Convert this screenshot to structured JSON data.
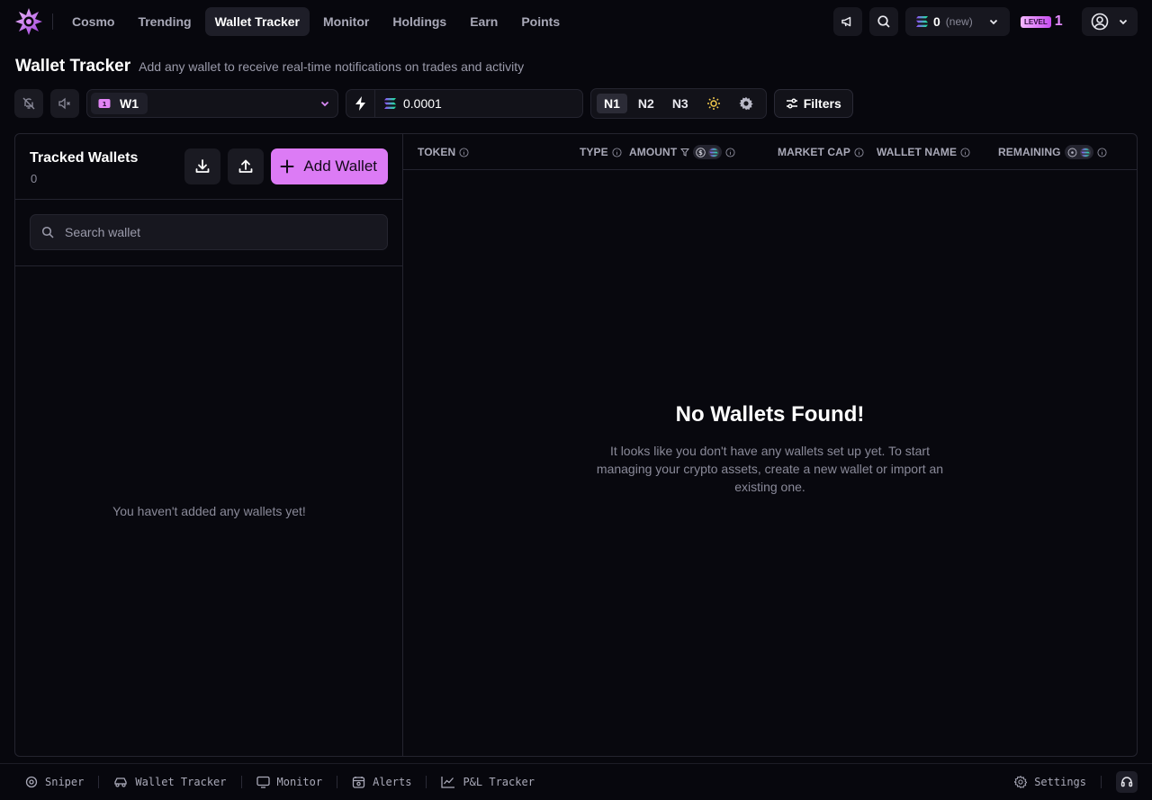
{
  "nav": {
    "links": [
      {
        "label": "Cosmo"
      },
      {
        "label": "Trending"
      },
      {
        "label": "Wallet Tracker"
      },
      {
        "label": "Monitor"
      },
      {
        "label": "Holdings"
      },
      {
        "label": "Earn"
      },
      {
        "label": "Points"
      }
    ],
    "active_index": 2,
    "balance": "0",
    "balance_note": "(new)",
    "level_badge": "LEVEL",
    "level_number": "1"
  },
  "header": {
    "title": "Wallet Tracker",
    "subtitle": "Add any wallet to receive real-time notifications on trades and activity"
  },
  "toolbar": {
    "wallet_icon_number": "1",
    "wallet_label": "W1",
    "amount_value": "0.0001",
    "presets": [
      "N1",
      "N2",
      "N3"
    ],
    "filters_label": "Filters"
  },
  "tracked": {
    "title": "Tracked Wallets",
    "count": "0",
    "add_label": "Add Wallet",
    "search_placeholder": "Search wallet",
    "empty_text": "You haven't added any wallets yet!"
  },
  "table": {
    "columns": {
      "token": "TOKEN",
      "type": "TYPE",
      "amount": "AMOUNT",
      "market_cap": "MARKET CAP",
      "wallet_name": "WALLET NAME",
      "remaining": "REMAINING"
    },
    "amount_dollar_glyph": "$",
    "empty_title": "No Wallets Found!",
    "empty_text": "It looks like you don't have any wallets set up yet. To start managing your crypto assets, create a new wallet or import an existing one."
  },
  "bottombar": {
    "items": [
      {
        "label": "Sniper"
      },
      {
        "label": "Wallet Tracker"
      },
      {
        "label": "Monitor"
      },
      {
        "label": "Alerts"
      },
      {
        "label": "P&L Tracker"
      }
    ],
    "settings_label": "Settings"
  },
  "colors": {
    "accent": "#dc7bf5",
    "background": "#07070d",
    "panel_border": "#24242f",
    "solana_gradient": [
      "#9945ff",
      "#14f195"
    ]
  },
  "icons": [
    "logo-icon",
    "megaphone-icon",
    "search-icon",
    "solana-icon",
    "chevron-down-icon",
    "user-circle-icon",
    "bell-off-icon",
    "volume-mute-icon",
    "wallet-icon",
    "bolt-icon",
    "sun-icon",
    "gear-icon",
    "sliders-icon",
    "download-icon",
    "upload-icon",
    "plus-icon",
    "info-icon",
    "filter-icon",
    "crosshair-icon",
    "car-icon",
    "monitor-icon",
    "alarm-icon",
    "chart-line-icon",
    "headset-icon"
  ]
}
